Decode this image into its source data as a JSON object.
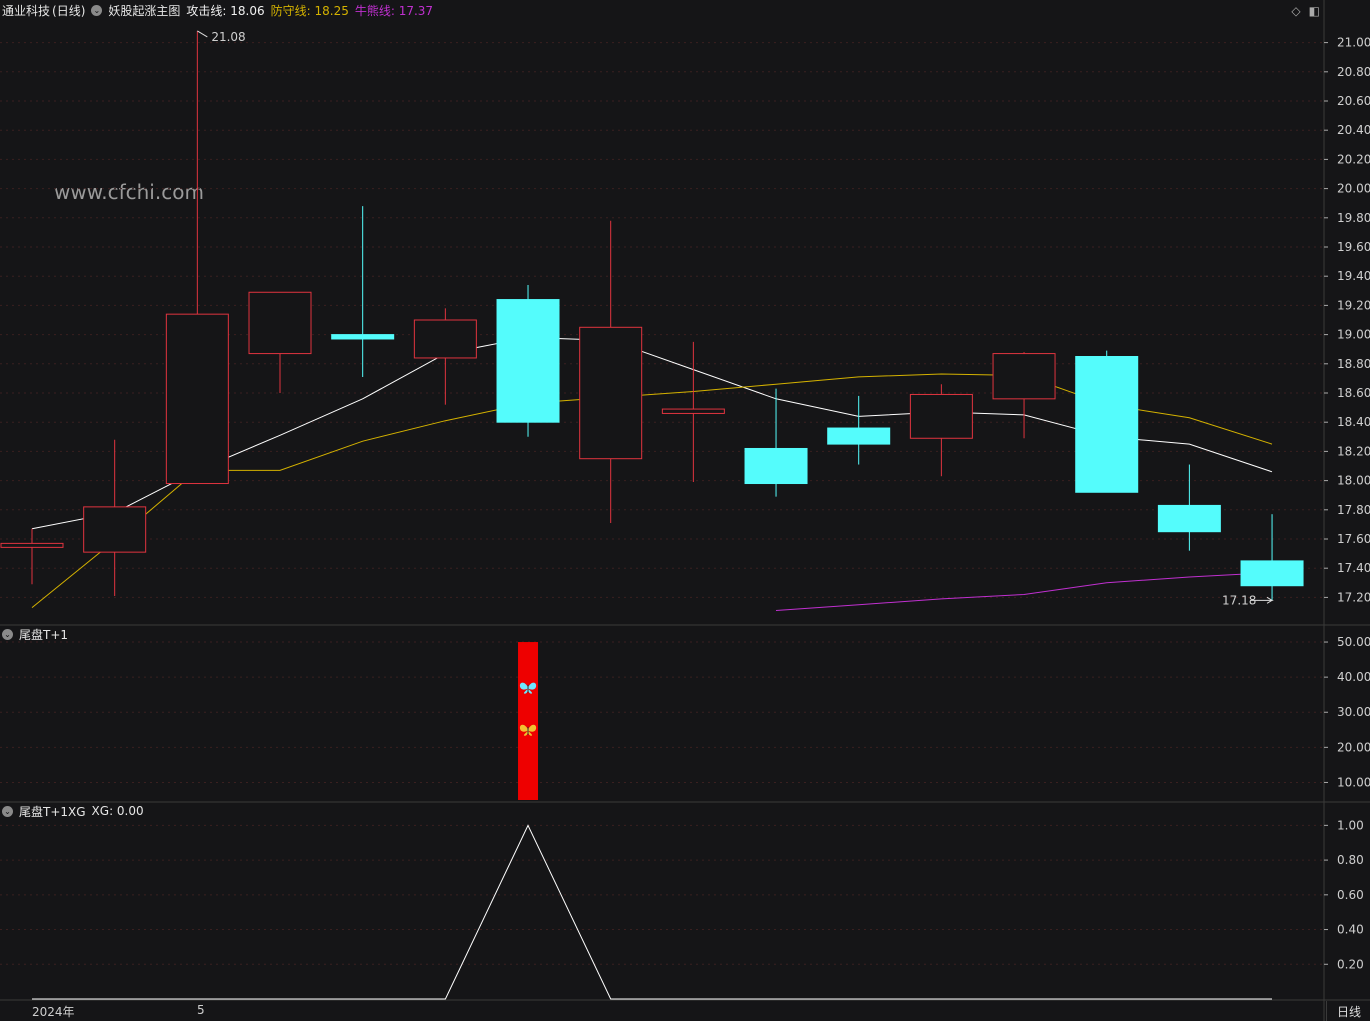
{
  "header": {
    "stock_name": "通业科技",
    "period": "(日线)",
    "indicator_name": "妖股起涨主图",
    "attack_label": "攻击线: 18.06",
    "defense_label": "防守线: 18.25",
    "bear_label": "牛熊线: 17.37"
  },
  "watermark": "www.cfchi.com",
  "colors": {
    "background": "#151517",
    "up": "#e0343f",
    "down": "#54fcfc",
    "attack": "#ffffff",
    "defense": "#d4b200",
    "bear": "#c030d0",
    "bar": "#ee0000",
    "grid": "#3a2020"
  },
  "panel2_header": {
    "title": "尾盘T+1"
  },
  "panel3_header": {
    "title": "尾盘T+1XG",
    "value": "XG: 0.00"
  },
  "bottom": {
    "year": "2024年",
    "month": "5",
    "period_button": "日线"
  },
  "window_icons": [
    "diamond-icon",
    "panel-toggle-icon"
  ],
  "chart_data": [
    {
      "type": "candlestick",
      "title": "妖股起涨主图",
      "ylim": [
        17.1,
        21.1
      ],
      "y_ticks": [
        "21.00",
        "20.80",
        "20.60",
        "20.40",
        "20.20",
        "20.00",
        "19.80",
        "19.60",
        "19.40",
        "19.20",
        "19.00",
        "18.80",
        "18.60",
        "18.40",
        "18.20",
        "18.00",
        "17.80",
        "17.60",
        "17.40",
        "17.20"
      ],
      "candles": [
        {
          "o": 17.55,
          "c": 17.57,
          "h": 17.67,
          "l": 17.29
        },
        {
          "o": 17.51,
          "c": 17.82,
          "h": 18.28,
          "l": 17.21
        },
        {
          "o": 17.98,
          "c": 19.14,
          "h": 21.08,
          "l": 17.98
        },
        {
          "o": 18.87,
          "c": 19.29,
          "h": 19.29,
          "l": 18.6
        },
        {
          "o": 19.0,
          "c": 18.97,
          "h": 19.88,
          "l": 18.71
        },
        {
          "o": 18.84,
          "c": 19.1,
          "h": 19.18,
          "l": 18.52
        },
        {
          "o": 19.24,
          "c": 18.4,
          "h": 19.34,
          "l": 18.3
        },
        {
          "o": 18.15,
          "c": 19.05,
          "h": 19.78,
          "l": 17.71
        },
        {
          "o": 18.46,
          "c": 18.49,
          "h": 18.95,
          "l": 17.99
        },
        {
          "o": 18.22,
          "c": 17.98,
          "h": 18.63,
          "l": 17.89
        },
        {
          "o": 18.36,
          "c": 18.25,
          "h": 18.58,
          "l": 18.11
        },
        {
          "o": 18.29,
          "c": 18.59,
          "h": 18.66,
          "l": 18.03
        },
        {
          "o": 18.56,
          "c": 18.87,
          "h": 18.88,
          "l": 18.29
        },
        {
          "o": 18.85,
          "c": 17.92,
          "h": 18.89,
          "l": 17.92
        },
        {
          "o": 17.83,
          "c": 17.65,
          "h": 18.11,
          "l": 17.52
        },
        {
          "o": 17.45,
          "c": 17.28,
          "h": 17.77,
          "l": 17.18
        }
      ],
      "series": [
        {
          "name": "攻击线",
          "values": [
            17.67,
            17.78,
            18.07,
            18.31,
            18.56,
            18.87,
            18.98,
            18.96,
            18.76,
            18.56,
            18.44,
            18.47,
            18.45,
            18.3,
            18.25,
            18.06
          ]
        },
        {
          "name": "防守线",
          "values": [
            17.13,
            17.59,
            18.07,
            18.07,
            18.27,
            18.41,
            18.53,
            18.57,
            18.61,
            18.66,
            18.71,
            18.73,
            18.72,
            18.52,
            18.43,
            18.25
          ]
        },
        {
          "name": "牛熊线",
          "values": [
            null,
            null,
            null,
            null,
            null,
            null,
            null,
            null,
            null,
            17.11,
            17.15,
            17.19,
            17.22,
            17.3,
            17.34,
            17.37
          ]
        }
      ],
      "annotations": [
        {
          "text": "21.08",
          "index": 2,
          "value": 21.08
        },
        {
          "text": "17.18",
          "index": 15,
          "value": 17.18
        }
      ]
    },
    {
      "type": "bar",
      "title": "尾盘T+1",
      "ylim": [
        5,
        54
      ],
      "y_ticks": [
        "50.00",
        "40.00",
        "30.00",
        "20.00",
        "10.00"
      ],
      "bars": [
        {
          "index": 6,
          "value": 50
        }
      ],
      "icons": [
        {
          "name": "butterfly-cyan-icon",
          "index": 6,
          "value": 37
        },
        {
          "name": "butterfly-yellow-icon",
          "index": 6,
          "value": 25
        }
      ]
    },
    {
      "type": "line",
      "title": "尾盘T+1XG",
      "ylim": [
        0,
        1.1
      ],
      "y_ticks": [
        "1.00",
        "0.80",
        "0.60",
        "0.40",
        "0.20"
      ],
      "series": [
        {
          "name": "XG",
          "values": [
            0,
            0,
            0,
            0,
            0,
            0,
            1,
            0,
            0,
            0,
            0,
            0,
            0,
            0,
            0,
            0
          ]
        }
      ]
    }
  ]
}
